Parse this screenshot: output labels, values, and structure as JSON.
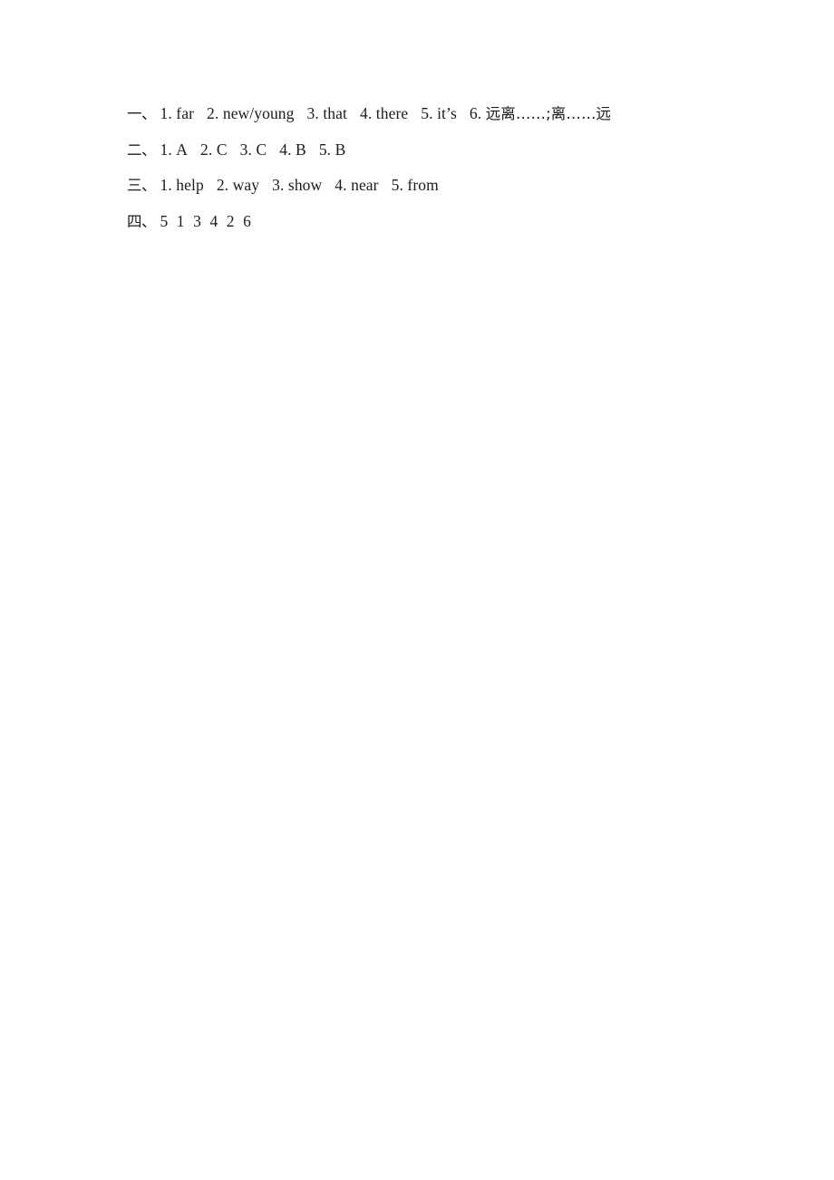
{
  "document": {
    "kind": "answer-key",
    "page_background": "#ffffff",
    "text_color": "#1c1c1c"
  },
  "sections": [
    {
      "marker": "一、",
      "name": "section-one",
      "type": "fill-in",
      "items": [
        {
          "num": "1.",
          "text": "far"
        },
        {
          "num": "2.",
          "text": "new/young"
        },
        {
          "num": "3.",
          "text": "that"
        },
        {
          "num": "4.",
          "text": "there"
        },
        {
          "num": "5.",
          "text": "it’s"
        },
        {
          "num": "6.",
          "text": "远离……;离……远",
          "script": "cjk"
        }
      ]
    },
    {
      "marker": "二、",
      "name": "section-two",
      "type": "multiple-choice",
      "items": [
        {
          "num": "1.",
          "text": "A"
        },
        {
          "num": "2.",
          "text": "C"
        },
        {
          "num": "3.",
          "text": "C"
        },
        {
          "num": "4.",
          "text": "B"
        },
        {
          "num": "5.",
          "text": "B"
        }
      ]
    },
    {
      "marker": "三、",
      "name": "section-three",
      "type": "fill-in",
      "items": [
        {
          "num": "1.",
          "text": "help"
        },
        {
          "num": "2.",
          "text": "way"
        },
        {
          "num": "3.",
          "text": "show"
        },
        {
          "num": "4.",
          "text": "near"
        },
        {
          "num": "5.",
          "text": "from"
        }
      ]
    },
    {
      "marker": "四、",
      "name": "section-four",
      "type": "ordering",
      "sequence": "5 1 3 4 2 6"
    }
  ]
}
